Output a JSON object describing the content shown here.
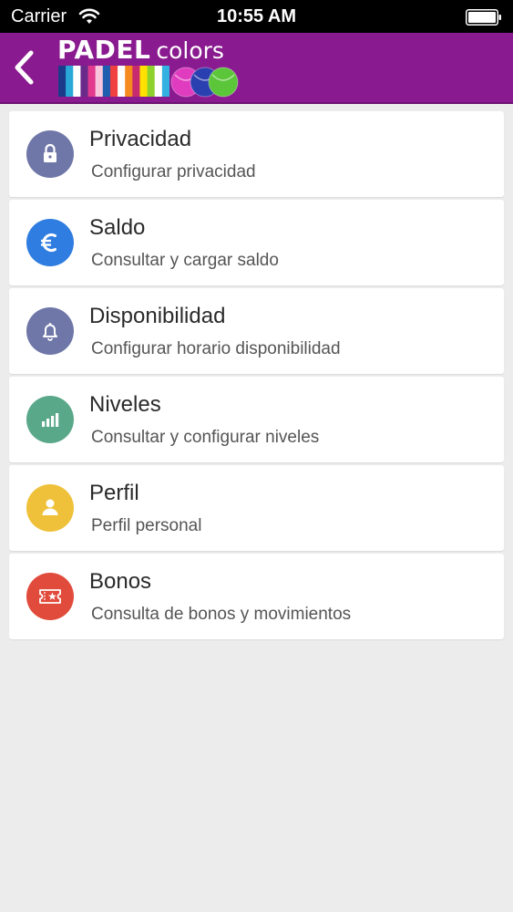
{
  "status_bar": {
    "carrier": "Carrier",
    "time": "10:55 AM"
  },
  "header": {
    "logo_word1": "PADEL",
    "logo_word2": "colors",
    "logo_stripe_colors": [
      "#1c3a8a",
      "#29a8d8",
      "#ffffff",
      "#6a2a8a",
      "#e23a8f",
      "#f7c6dc",
      "#1e5fb0",
      "#f04040",
      "#ffffff",
      "#f58a1f",
      "#c72a6e",
      "#ffe100",
      "#8fd12c",
      "#ffffff",
      "#33b1e0"
    ],
    "ball_colors": [
      "#e03cbf",
      "#2a3fb0",
      "#5cc63a"
    ]
  },
  "menu": {
    "items": [
      {
        "title": "Privacidad",
        "subtitle": "Configurar privacidad",
        "icon": "lock-icon",
        "color": "#6f77a8"
      },
      {
        "title": "Saldo",
        "subtitle": "Consultar y cargar saldo",
        "icon": "euro-icon",
        "color": "#2f7de0"
      },
      {
        "title": "Disponibilidad",
        "subtitle": "Configurar horario disponibilidad",
        "icon": "bell-icon",
        "color": "#6f77a8"
      },
      {
        "title": "Niveles",
        "subtitle": "Consultar y configurar niveles",
        "icon": "bars-icon",
        "color": "#5aa88a"
      },
      {
        "title": "Perfil",
        "subtitle": "Perfil personal",
        "icon": "person-icon",
        "color": "#efc13a"
      },
      {
        "title": "Bonos",
        "subtitle": "Consulta de bonos y movimientos",
        "icon": "ticket-icon",
        "color": "#e14b3b"
      }
    ]
  }
}
